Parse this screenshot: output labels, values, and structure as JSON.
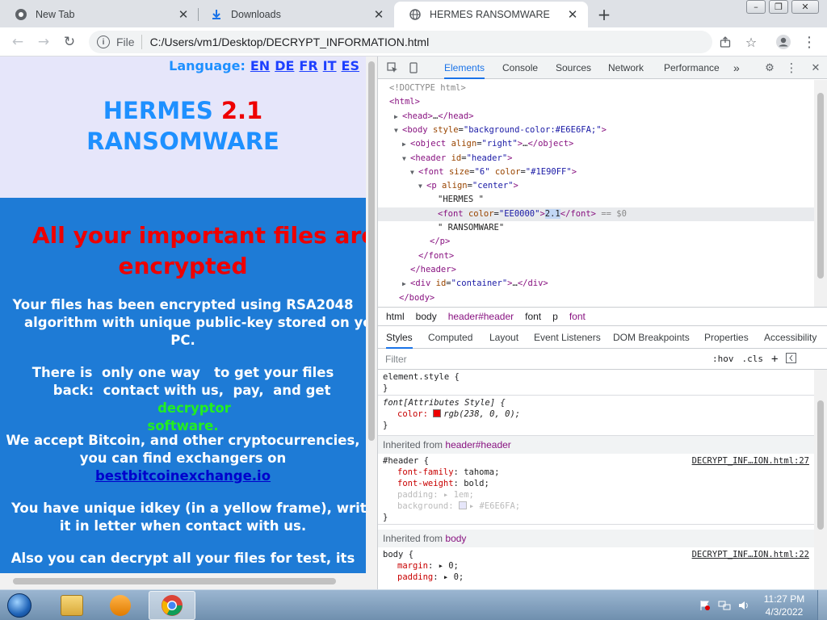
{
  "browser": {
    "tabs": [
      {
        "title": "New Tab",
        "icon": "chrome-icon"
      },
      {
        "title": "Downloads",
        "icon": "download-icon"
      },
      {
        "title": "HERMES RANSOMWARE",
        "icon": "globe-icon"
      }
    ],
    "close_glyph": "✕",
    "new_tab_glyph": "+",
    "window_buttons": {
      "minimize": "–",
      "restore": "❐",
      "close": "✕"
    },
    "address": {
      "scheme": "File",
      "url": "C:/Users/vm1/Desktop/DECRYPT_INFORMATION.html"
    }
  },
  "page": {
    "language_label": "Language:",
    "languages": [
      "EN",
      "DE",
      "FR",
      "IT",
      "ES"
    ],
    "title_part1": "HERMES ",
    "title_version": "2.1",
    "title_part2": "RANSOMWARE",
    "heading_line1": "All your important files are",
    "heading_line2": "encrypted",
    "p1_line1": "Your files has been encrypted using RSA2048",
    "p1_line2": "algorithm with unique public-key stored on your",
    "p1_line3": "PC.",
    "p2_line1": "There is  only one way   to get your files",
    "p2_line2_a": "back:  contact with us,  pay,  and get ",
    "p2_line2_b": "decryptor",
    "p2_line3": "software.",
    "p3_line1": "We accept Bitcoin, and other cryptocurrencies,",
    "p3_line2": "you can find exchangers on",
    "p3_link": "bestbitcoinexchange.io",
    "p4_line1": "You have unique idkey (in a yellow frame), write",
    "p4_line2": "it in letter when contact with us.",
    "p5_line1": "Also you can decrypt all your files for test, its"
  },
  "devtools": {
    "tabs": [
      "Elements",
      "Console",
      "Sources",
      "Network",
      "Performance"
    ],
    "more_glyph": "»",
    "dom_lines": [
      {
        "html": "<span class='cmt'>&lt;!DOCTYPE html&gt;</span>"
      },
      {
        "html": "<span class='tag'>&lt;html&gt;</span>"
      },
      {
        "html": "<span class='tri'>▶</span><span class='tag'>&lt;head&gt;</span>…<span class='tag'>&lt;/head&gt;</span>"
      },
      {
        "html": "<span class='tri'>▼</span><span class='tag'>&lt;body</span> <span class='attr'>style</span>=<span class='val'>\"background-color:#E6E6FA;\"</span><span class='tag'>&gt;</span>"
      },
      {
        "html": "<span class='tri'>▶</span><span class='tag'>&lt;object</span> <span class='attr'>align</span>=<span class='val'>\"right\"</span><span class='tag'>&gt;</span>…<span class='tag'>&lt;/object&gt;</span>"
      },
      {
        "html": "<span class='tri'>▼</span><span class='tag'>&lt;header</span> <span class='attr'>id</span>=<span class='val'>\"header\"</span><span class='tag'>&gt;</span>"
      },
      {
        "html": "<span class='tri'>▼</span><span class='tag'>&lt;font</span> <span class='attr'>size</span>=<span class='val'>\"6\"</span> <span class='attr'>color</span>=<span class='val'>\"#1E90FF\"</span><span class='tag'>&gt;</span>"
      },
      {
        "html": "<span class='tri'>▼</span><span class='tag'>&lt;p</span> <span class='attr'>align</span>=<span class='val'>\"center\"</span><span class='tag'>&gt;</span>"
      },
      {
        "html": "<span class='txt'>\"HERMES \"</span>"
      },
      {
        "html": "<span class='tag'>&lt;font</span> <span class='attr'>color</span>=<span class='val'>\"EE0000\"</span><span class='tag'>&gt;</span><span style='background:#c2d7f5'>2.1</span><span class='tag'>&lt;/font&gt;</span> <span class='cmt'>== $0</span>"
      },
      {
        "html": "<span class='txt'>\" RANSOMWARE\"</span>"
      },
      {
        "html": "<span class='tag'>&lt;/p&gt;</span>"
      },
      {
        "html": "<span class='tag'>&lt;/font&gt;</span>"
      },
      {
        "html": "<span class='tag'>&lt;/header&gt;</span>"
      },
      {
        "html": "<span class='tri'>▶</span><span class='tag'>&lt;div</span> <span class='attr'>id</span>=<span class='val'>\"container\"</span><span class='tag'>&gt;</span>…<span class='tag'>&lt;/div&gt;</span>"
      },
      {
        "html": "<span class='tag'>&lt;/body&gt;</span>"
      }
    ],
    "breadcrumb": [
      "html",
      "body",
      "header#header",
      "font",
      "p",
      "font"
    ],
    "style_tabs": [
      "Styles",
      "Computed",
      "Layout",
      "Event Listeners",
      "DOM Breakpoints",
      "Properties",
      "Accessibility"
    ],
    "filter_placeholder": "Filter",
    "filter_buttons": [
      ":hov",
      ".cls",
      "+"
    ],
    "rule_element_style": "element.style {",
    "rule_close": "}",
    "rule_font_selector": "font[Attributes Style] {",
    "rule_font_prop": "color:",
    "rule_font_val": "rgb(238, 0, 0);",
    "inherited_label": "Inherited from",
    "inherited_header": "header#header",
    "rule_header_selector": "#header {",
    "rule_header_src": "DECRYPT_INF…ION.html:27",
    "header_props": [
      {
        "name": "font-family",
        "value": "tahoma;"
      },
      {
        "name": "font-weight",
        "value": "bold;"
      },
      {
        "name": "padding",
        "value": "▸ 1em;"
      },
      {
        "name": "background",
        "value": "▸ #E6E6FA;"
      }
    ],
    "inherited_body": "body",
    "rule_body_selector": "body {",
    "rule_body_src": "DECRYPT_INF…ION.html:22",
    "body_props": [
      {
        "name": "margin",
        "value": "▸ 0;"
      },
      {
        "name": "padding",
        "value": "▸ 0;"
      }
    ]
  },
  "taskbar": {
    "time": "11:27 PM",
    "date": "4/3/2022"
  }
}
